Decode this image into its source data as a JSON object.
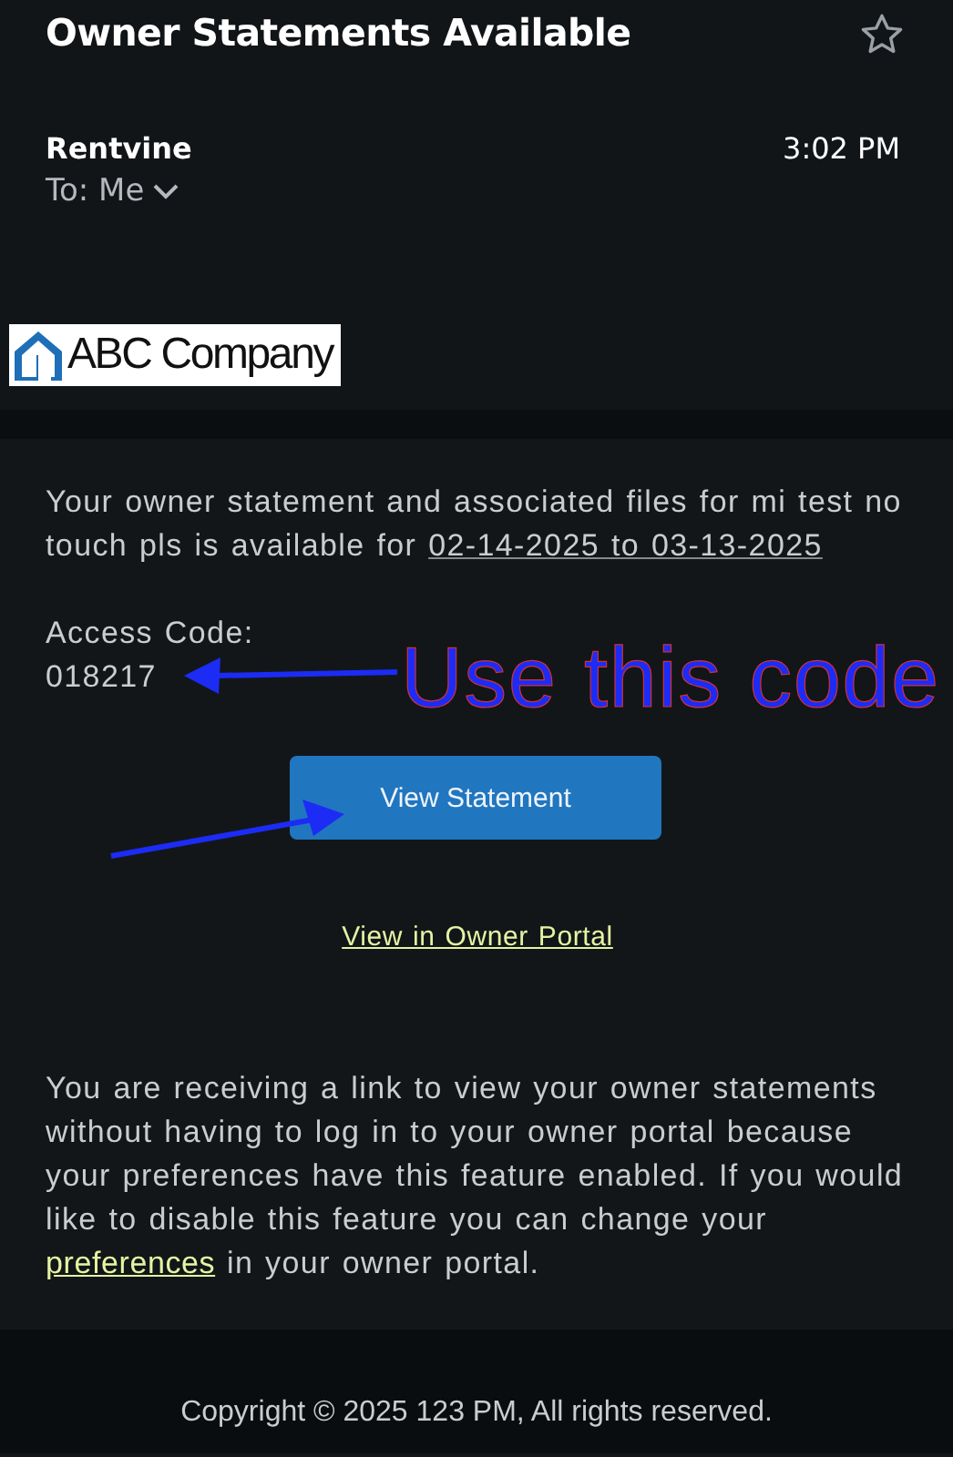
{
  "email": {
    "subject": "Owner Statements Available",
    "starred": false,
    "sender": "Rentvine",
    "recipient": "To: Me",
    "time": "3:02 PM"
  },
  "logo": {
    "text": "ABC Company"
  },
  "body": {
    "intro": "Your owner statement and associated files for mi test no touch pls is available for ",
    "date_range": "02-14-2025 to 03-13-2025",
    "access_code_label": "Access Code:",
    "access_code": "018217",
    "button": "View Statement",
    "portal_link": "View in Owner Portal",
    "notice": "You are receiving a link to view your owner statements without having to log in to your owner portal because your preferences have this feature enabled. If you would like to disable this feature you can change your ",
    "notice_link": "preferences",
    "notice_end": " in your owner portal."
  },
  "annotations": [
    {
      "kind": "label-arrow",
      "text": "Use this code"
    },
    {
      "kind": "arrow"
    }
  ],
  "footer": {
    "copyright": "Copyright © 2025 123 PM, All rights reserved."
  }
}
